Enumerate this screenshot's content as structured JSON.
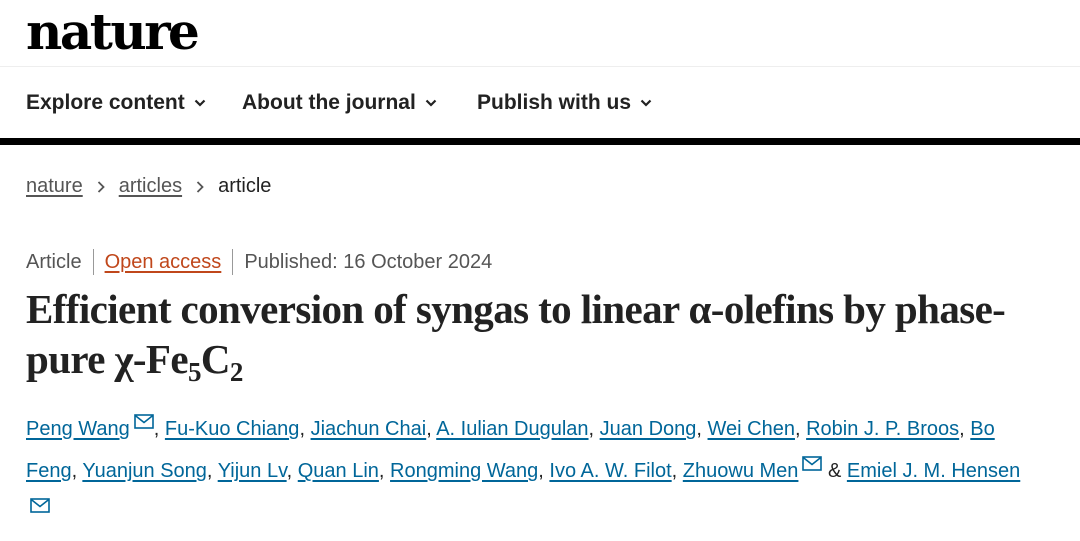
{
  "site": {
    "logo": "nature"
  },
  "nav": {
    "items": [
      {
        "label": "Explore content"
      },
      {
        "label": "About the journal"
      },
      {
        "label": "Publish with us"
      }
    ]
  },
  "breadcrumb": {
    "items": [
      "nature",
      "articles"
    ],
    "current": "article"
  },
  "meta": {
    "type": "Article",
    "access": "Open access",
    "published": "Published: 16 October 2024"
  },
  "title": {
    "main": "Efficient conversion of syngas to linear α-olefins by phase-pure χ-Fe",
    "sub1": "5",
    "mid": "C",
    "sub2": "2"
  },
  "authors": {
    "list": [
      "Peng Wang",
      "Fu-Kuo Chiang",
      "Jiachun Chai",
      "A. Iulian Dugulan",
      "Juan Dong",
      "Wei Chen",
      "Robin J. P. Broos",
      "Bo Feng",
      "Yuanjun Song",
      "Yijun Lv",
      "Quan Lin",
      "Rongming Wang",
      "Ivo A. W. Filot",
      "Zhuowu Men",
      "Emiel J. M. Hensen"
    ],
    "separator": ", ",
    "ampersand": " & ",
    "mail_icon": "envelope-icon"
  },
  "colors": {
    "link": "#006699",
    "open_access": "#c0471b",
    "text": "#222222",
    "muted": "#555555"
  }
}
